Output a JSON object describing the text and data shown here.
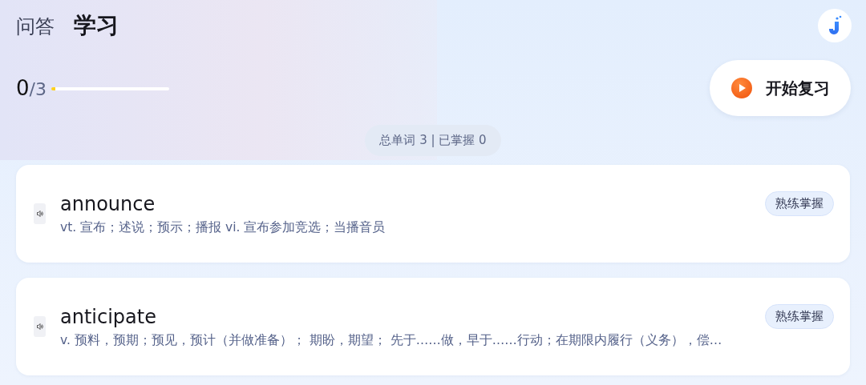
{
  "tabs": [
    {
      "label": "问答",
      "selected": false
    },
    {
      "label": "学习",
      "selected": true
    }
  ],
  "progress": {
    "done": "0",
    "total": "/3",
    "level": 0
  },
  "review_button": {
    "label": "开始复习"
  },
  "stats": "总单词 3 | 已掌握 0",
  "words": [
    {
      "word": "announce",
      "definition": "vt. 宣布；述说；预示；播报 vi. 宣布参加竞选；当播音员",
      "tag": "熟练掌握"
    },
    {
      "word": "anticipate",
      "definition": "v. 预料，预期；预见，预计（并做准备）； 期盼，期望； 先于……做，早于……行动；在期限内履行（义务），偿…",
      "tag": "熟练掌握"
    }
  ]
}
